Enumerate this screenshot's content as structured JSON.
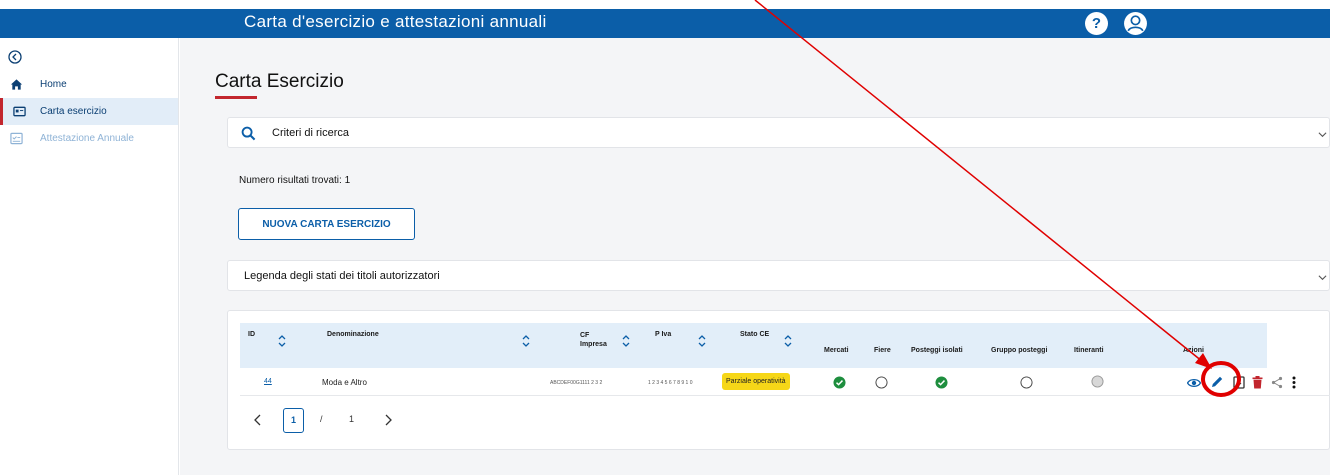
{
  "header": {
    "app_title": "Carta d'esercizio e attestazioni annuali",
    "help_icon": "help-circle-icon",
    "help_glyph": "?",
    "user_icon": "user-account-icon",
    "bar_color": "#0b5ea8"
  },
  "sidebar": {
    "collapse_icon": "collapse-arrow-icon",
    "items": [
      {
        "label": "Home",
        "icon": "home-icon",
        "state": "normal"
      },
      {
        "label": "Carta esercizio",
        "icon": "card-icon",
        "state": "active"
      },
      {
        "label": "Attestazione Annuale",
        "icon": "document-check-icon",
        "state": "disabled"
      }
    ],
    "active_accent": "#c2262e"
  },
  "main": {
    "page_title": "Carta Esercizio",
    "search_panel": {
      "label": "Criteri di ricerca",
      "icon": "search-icon",
      "expanded": false
    },
    "results_count": "Numero risultati trovati: 1",
    "new_button": "NUOVA CARTA ESERCIZIO",
    "legend_panel": {
      "label": "Legenda degli stati dei titoli autorizzatori",
      "expanded": false
    }
  },
  "table": {
    "columns": [
      {
        "label": "ID",
        "sortable": true
      },
      {
        "label": "Denominazione",
        "sortable": true
      },
      {
        "label": "CF Impresa",
        "sortable": true
      },
      {
        "label": "P Iva",
        "sortable": true
      },
      {
        "label": "Stato CE",
        "sortable": true
      },
      {
        "label": "Mercati",
        "sortable": false
      },
      {
        "label": "Fiere",
        "sortable": false
      },
      {
        "label": "Posteggi isolati",
        "sortable": false
      },
      {
        "label": "Gruppo posteggi",
        "sortable": false
      },
      {
        "label": "Itineranti",
        "sortable": false
      },
      {
        "label": "Azioni",
        "sortable": false
      }
    ],
    "rows": [
      {
        "id": "44",
        "denominazione": "Moda e Altro",
        "cf_impresa": "ABCDEF00G1111 2 3 2",
        "p_iva": "1 2 3 4 5 6 7 8 9 1 0",
        "stato_ce": "Parziale operatività",
        "mercati": "check",
        "fiere": "empty",
        "posteggi_isolati": "check",
        "gruppo_posteggi": "empty",
        "itineranti": "disabled",
        "actions": [
          "view-icon",
          "edit-icon",
          "export-icon",
          "delete-icon",
          "share-icon",
          "more-vertical-icon"
        ]
      }
    ],
    "pagination": {
      "current_page": "1",
      "separator": "/",
      "total_pages": "1",
      "prev_icon": "chevron-left-icon",
      "next_icon": "chevron-right-icon"
    }
  },
  "colors": {
    "primary": "#0b5ea8",
    "accent_red": "#c2262e",
    "status_green": "#1e8e3e",
    "badge_yellow": "#f6d718",
    "header_cell": "#e2eef9",
    "annotation_red": "#e00000"
  },
  "annotation": {
    "type": "arrow-and-circle",
    "target": "edit-icon",
    "color": "#e00000"
  }
}
